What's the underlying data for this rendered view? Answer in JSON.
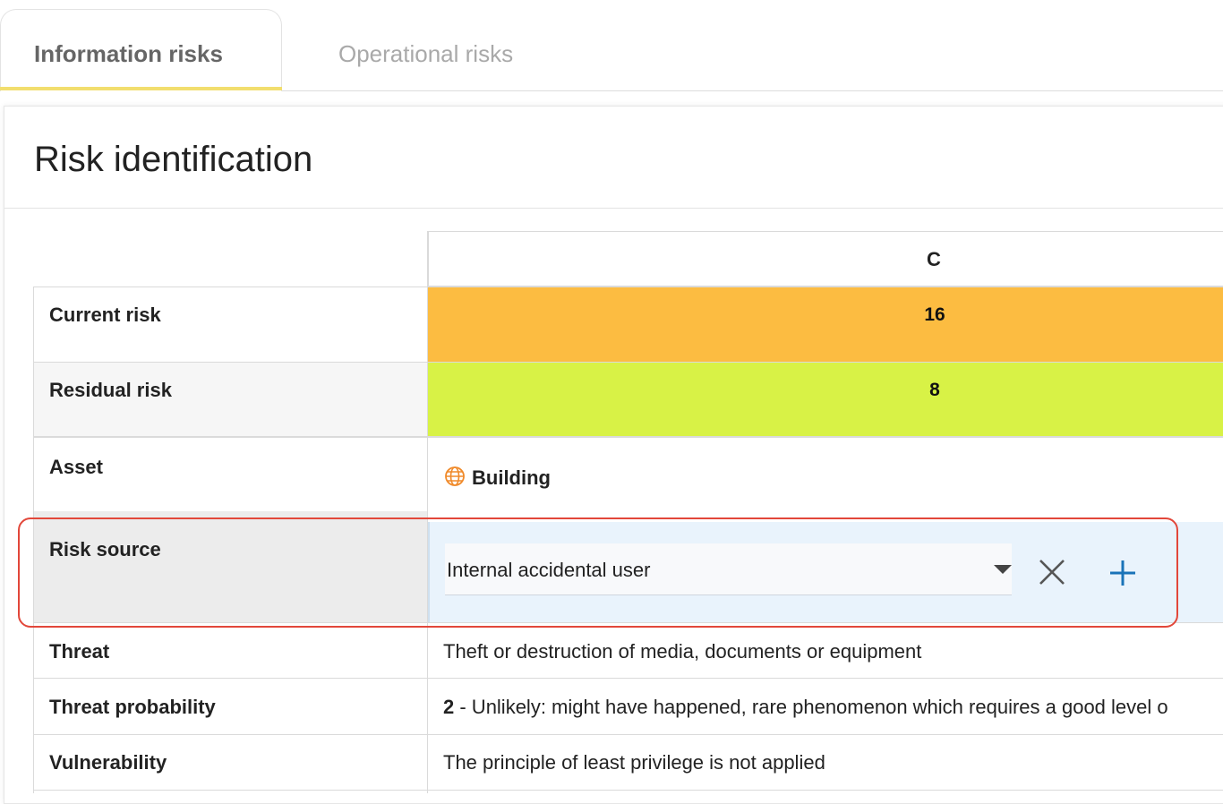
{
  "tabs": [
    {
      "label": "Information risks",
      "active": true
    },
    {
      "label": "Operational risks",
      "active": false
    }
  ],
  "panel": {
    "title": "Risk identification"
  },
  "table": {
    "column_header": "C",
    "current_risk": {
      "label": "Current risk",
      "value": "16",
      "color": "#fcbc41"
    },
    "residual_risk": {
      "label": "Residual risk",
      "value": "8",
      "color": "#d8f246"
    },
    "asset": {
      "label": "Asset",
      "value": "Building",
      "icon": "globe-icon",
      "icon_color": "#f08a2a"
    },
    "risk_source": {
      "label": "Risk source",
      "selected": "Internal accidental user",
      "clear_icon": "close-icon",
      "add_icon": "plus-icon",
      "add_color": "#1a73b8",
      "highlight_color": "#e2473a"
    },
    "threat": {
      "label": "Threat",
      "value": "Theft or destruction of media, documents or equipment"
    },
    "threat_probability": {
      "label": "Threat probability",
      "score": "2",
      "description": " - Unlikely: might have happened, rare phenomenon which requires a good level o"
    },
    "vulnerability": {
      "label": "Vulnerability",
      "value": "The principle of least privilege is not applied"
    }
  }
}
